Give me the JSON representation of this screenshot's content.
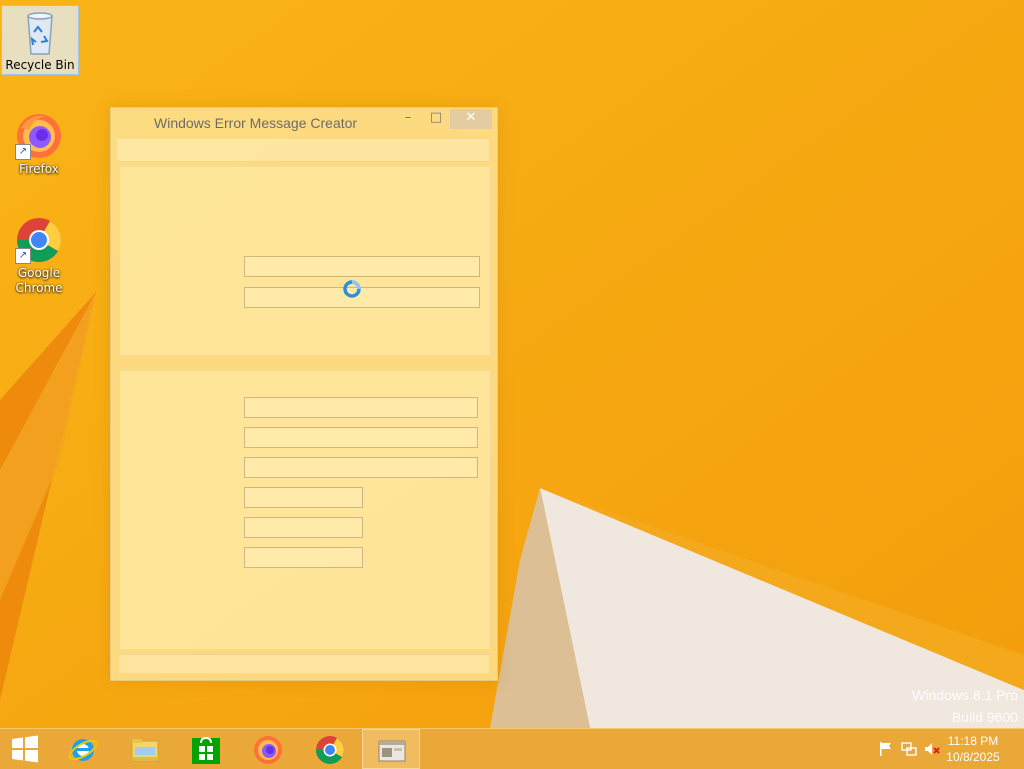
{
  "desktop": {
    "icons": [
      {
        "label": "Recycle Bin",
        "icon": "recycle-bin-icon"
      },
      {
        "label": "Firefox",
        "icon": "firefox-icon"
      },
      {
        "label": "Google Chrome",
        "icon": "chrome-icon"
      }
    ],
    "watermark": {
      "line1": "Windows 8.1 Pro",
      "line2": "Build 9600"
    }
  },
  "window": {
    "title": "Windows Error Message Creator",
    "buttons": {
      "minimize": "–",
      "maximize": "□",
      "close": "✕"
    },
    "fields": {
      "top_group": [
        "",
        ""
      ],
      "bottom_group": [
        "",
        "",
        "",
        "",
        "",
        ""
      ]
    }
  },
  "taskbar": {
    "apps": [
      {
        "name": "Start",
        "icon": "windows-start-icon"
      },
      {
        "name": "Internet Explorer",
        "icon": "internet-explorer-icon"
      },
      {
        "name": "File Explorer",
        "icon": "file-explorer-icon"
      },
      {
        "name": "Store",
        "icon": "store-icon"
      },
      {
        "name": "Firefox",
        "icon": "firefox-icon"
      },
      {
        "name": "Google Chrome",
        "icon": "chrome-icon"
      },
      {
        "name": "Windows Error Message Creator",
        "icon": "app-window-icon"
      }
    ],
    "tray": {
      "icons": [
        "action-center-flag-icon",
        "network-icon",
        "volume-muted-icon"
      ]
    },
    "clock": {
      "time": "11:18 PM",
      "date": "10/8/2025"
    }
  },
  "colors": {
    "accent": "#f6ac0c",
    "taskbar": "#e8a83c",
    "window": "#ffecaa"
  }
}
